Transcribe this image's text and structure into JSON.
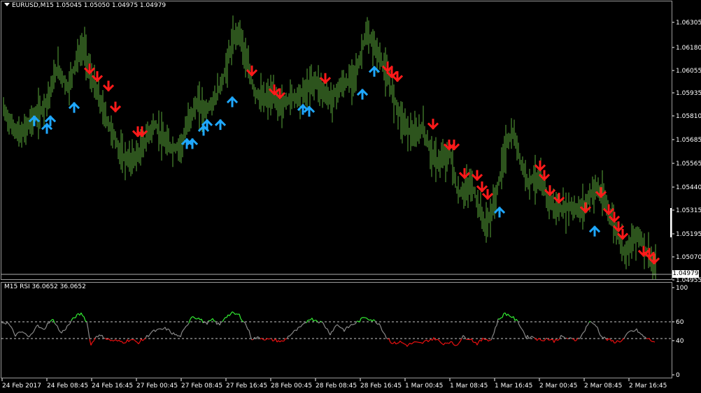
{
  "chart": {
    "header_label": "EURUSD,M15  1.05045 1.05050 1.04975 1.04979",
    "current_price": "1.04979",
    "price_ticks": [
      "1.06305",
      "1.06180",
      "1.06055",
      "1.05935",
      "1.05810",
      "1.05685",
      "1.05565",
      "1.05440",
      "1.05315",
      "1.05195",
      "1.05070",
      "1.04955"
    ],
    "time_ticks": [
      "24 Feb 2017",
      "24 Feb 08:45",
      "24 Feb 16:45",
      "27 Feb 00:45",
      "27 Feb 08:45",
      "27 Feb 16:45",
      "28 Feb 00:45",
      "28 Feb 08:45",
      "28 Feb 16:45",
      "1 Mar 00:45",
      "1 Mar 08:45",
      "1 Mar 16:45",
      "2 Mar 00:45",
      "2 Mar 08:45",
      "2 Mar 16:45"
    ],
    "colors": {
      "bar": "#5aa83a",
      "down_arrow": "#ff1a1a",
      "up_arrow": "#1fa8ff",
      "rsi_up": "#33ee33",
      "rsi_mid": "#8a8a8a",
      "rsi_down": "#ee1111"
    }
  },
  "rsi": {
    "label": "M15 RSI  36.0652 36.0652",
    "ticks": [
      "100",
      "60",
      "40",
      "0"
    ],
    "levels": [
      60,
      40
    ]
  },
  "chart_data": {
    "type": "line",
    "ylim": [
      1.0495,
      1.0636
    ],
    "close_series": [
      {
        "x": 0,
        "y": 1.0585
      },
      {
        "x": 15,
        "y": 1.0574
      },
      {
        "x": 28,
        "y": 1.0569
      },
      {
        "x": 42,
        "y": 1.0577
      },
      {
        "x": 55,
        "y": 1.0581
      },
      {
        "x": 68,
        "y": 1.059
      },
      {
        "x": 80,
        "y": 1.0605
      },
      {
        "x": 95,
        "y": 1.0594
      },
      {
        "x": 108,
        "y": 1.061
      },
      {
        "x": 118,
        "y": 1.0616
      },
      {
        "x": 128,
        "y": 1.06
      },
      {
        "x": 140,
        "y": 1.0588
      },
      {
        "x": 150,
        "y": 1.0578
      },
      {
        "x": 162,
        "y": 1.0568
      },
      {
        "x": 172,
        "y": 1.0558
      },
      {
        "x": 185,
        "y": 1.0556
      },
      {
        "x": 198,
        "y": 1.056
      },
      {
        "x": 210,
        "y": 1.057
      },
      {
        "x": 220,
        "y": 1.0575
      },
      {
        "x": 232,
        "y": 1.0566
      },
      {
        "x": 245,
        "y": 1.0562
      },
      {
        "x": 258,
        "y": 1.0564
      },
      {
        "x": 268,
        "y": 1.0578
      },
      {
        "x": 280,
        "y": 1.0586
      },
      {
        "x": 292,
        "y": 1.0582
      },
      {
        "x": 305,
        "y": 1.0588
      },
      {
        "x": 318,
        "y": 1.06
      },
      {
        "x": 330,
        "y": 1.0618
      },
      {
        "x": 340,
        "y": 1.0625
      },
      {
        "x": 350,
        "y": 1.0608
      },
      {
        "x": 362,
        "y": 1.0592
      },
      {
        "x": 375,
        "y": 1.0588
      },
      {
        "x": 388,
        "y": 1.059
      },
      {
        "x": 400,
        "y": 1.0584
      },
      {
        "x": 412,
        "y": 1.0589
      },
      {
        "x": 425,
        "y": 1.059
      },
      {
        "x": 438,
        "y": 1.0594
      },
      {
        "x": 450,
        "y": 1.0598
      },
      {
        "x": 462,
        "y": 1.0591
      },
      {
        "x": 472,
        "y": 1.0588
      },
      {
        "x": 485,
        "y": 1.0595
      },
      {
        "x": 498,
        "y": 1.0598
      },
      {
        "x": 510,
        "y": 1.0605
      },
      {
        "x": 520,
        "y": 1.0622
      },
      {
        "x": 530,
        "y": 1.0618
      },
      {
        "x": 540,
        "y": 1.0611
      },
      {
        "x": 552,
        "y": 1.06
      },
      {
        "x": 562,
        "y": 1.0588
      },
      {
        "x": 572,
        "y": 1.0578
      },
      {
        "x": 582,
        "y": 1.0572
      },
      {
        "x": 592,
        "y": 1.0568
      },
      {
        "x": 602,
        "y": 1.0574
      },
      {
        "x": 612,
        "y": 1.0562
      },
      {
        "x": 622,
        "y": 1.0555
      },
      {
        "x": 632,
        "y": 1.0557
      },
      {
        "x": 642,
        "y": 1.056
      },
      {
        "x": 652,
        "y": 1.0538
      },
      {
        "x": 662,
        "y": 1.054
      },
      {
        "x": 672,
        "y": 1.0544
      },
      {
        "x": 682,
        "y": 1.0532
      },
      {
        "x": 692,
        "y": 1.0521
      },
      {
        "x": 702,
        "y": 1.053
      },
      {
        "x": 712,
        "y": 1.0546
      },
      {
        "x": 722,
        "y": 1.0565
      },
      {
        "x": 732,
        "y": 1.057
      },
      {
        "x": 742,
        "y": 1.0556
      },
      {
        "x": 752,
        "y": 1.0545
      },
      {
        "x": 762,
        "y": 1.0547
      },
      {
        "x": 772,
        "y": 1.0544
      },
      {
        "x": 782,
        "y": 1.0535
      },
      {
        "x": 792,
        "y": 1.0531
      },
      {
        "x": 802,
        "y": 1.053
      },
      {
        "x": 812,
        "y": 1.0532
      },
      {
        "x": 822,
        "y": 1.053
      },
      {
        "x": 832,
        "y": 1.0531
      },
      {
        "x": 842,
        "y": 1.0538
      },
      {
        "x": 850,
        "y": 1.0542
      },
      {
        "x": 860,
        "y": 1.0536
      },
      {
        "x": 870,
        "y": 1.0528
      },
      {
        "x": 880,
        "y": 1.0518
      },
      {
        "x": 890,
        "y": 1.0508
      },
      {
        "x": 900,
        "y": 1.0512
      },
      {
        "x": 910,
        "y": 1.0518
      },
      {
        "x": 920,
        "y": 1.051
      },
      {
        "x": 930,
        "y": 1.0502
      },
      {
        "x": 935,
        "y": 1.0498
      }
    ],
    "down_signals": [
      {
        "x": 126,
        "y": 1.0602
      },
      {
        "x": 137,
        "y": 1.0598
      },
      {
        "x": 153,
        "y": 1.0593
      },
      {
        "x": 163,
        "y": 1.0582
      },
      {
        "x": 195,
        "y": 1.0569
      },
      {
        "x": 201,
        "y": 1.0569
      },
      {
        "x": 358,
        "y": 1.0601
      },
      {
        "x": 390,
        "y": 1.0591
      },
      {
        "x": 398,
        "y": 1.0589
      },
      {
        "x": 463,
        "y": 1.0597
      },
      {
        "x": 552,
        "y": 1.0603
      },
      {
        "x": 558,
        "y": 1.06
      },
      {
        "x": 566,
        "y": 1.0598
      },
      {
        "x": 617,
        "y": 1.0573
      },
      {
        "x": 640,
        "y": 1.0562
      },
      {
        "x": 647,
        "y": 1.0562
      },
      {
        "x": 662,
        "y": 1.0547
      },
      {
        "x": 680,
        "y": 1.0546
      },
      {
        "x": 687,
        "y": 1.054
      },
      {
        "x": 695,
        "y": 1.0536
      },
      {
        "x": 770,
        "y": 1.0551
      },
      {
        "x": 776,
        "y": 1.0546
      },
      {
        "x": 784,
        "y": 1.0538
      },
      {
        "x": 797,
        "y": 1.0534
      },
      {
        "x": 835,
        "y": 1.0529
      },
      {
        "x": 857,
        "y": 1.0537
      },
      {
        "x": 868,
        "y": 1.0528
      },
      {
        "x": 876,
        "y": 1.0524
      },
      {
        "x": 882,
        "y": 1.0519
      },
      {
        "x": 888,
        "y": 1.0515
      },
      {
        "x": 918,
        "y": 1.0506
      },
      {
        "x": 926,
        "y": 1.0505
      },
      {
        "x": 933,
        "y": 1.0502
      }
    ],
    "up_signals": [
      {
        "x": 47,
        "y": 1.0579
      },
      {
        "x": 65,
        "y": 1.0575
      },
      {
        "x": 70,
        "y": 1.0579
      },
      {
        "x": 104,
        "y": 1.0586
      },
      {
        "x": 265,
        "y": 1.0567
      },
      {
        "x": 273,
        "y": 1.0567
      },
      {
        "x": 289,
        "y": 1.0574
      },
      {
        "x": 294,
        "y": 1.0577
      },
      {
        "x": 313,
        "y": 1.0577
      },
      {
        "x": 330,
        "y": 1.0589
      },
      {
        "x": 431,
        "y": 1.0585
      },
      {
        "x": 440,
        "y": 1.0584
      },
      {
        "x": 516,
        "y": 1.0593
      },
      {
        "x": 533,
        "y": 1.0605
      },
      {
        "x": 712,
        "y": 1.0531
      },
      {
        "x": 848,
        "y": 1.0521
      }
    ],
    "rsi_values": [
      {
        "x": 0,
        "y": 60
      },
      {
        "x": 10,
        "y": 58
      },
      {
        "x": 20,
        "y": 44
      },
      {
        "x": 30,
        "y": 48
      },
      {
        "x": 40,
        "y": 41
      },
      {
        "x": 50,
        "y": 56
      },
      {
        "x": 60,
        "y": 50
      },
      {
        "x": 68,
        "y": 60
      },
      {
        "x": 75,
        "y": 62
      },
      {
        "x": 85,
        "y": 46
      },
      {
        "x": 95,
        "y": 55
      },
      {
        "x": 105,
        "y": 66
      },
      {
        "x": 115,
        "y": 70
      },
      {
        "x": 122,
        "y": 60
      },
      {
        "x": 128,
        "y": 32
      },
      {
        "x": 136,
        "y": 44
      },
      {
        "x": 146,
        "y": 42
      },
      {
        "x": 155,
        "y": 38
      },
      {
        "x": 165,
        "y": 37
      },
      {
        "x": 175,
        "y": 36
      },
      {
        "x": 185,
        "y": 39
      },
      {
        "x": 195,
        "y": 35
      },
      {
        "x": 205,
        "y": 40
      },
      {
        "x": 215,
        "y": 48
      },
      {
        "x": 225,
        "y": 50
      },
      {
        "x": 235,
        "y": 52
      },
      {
        "x": 245,
        "y": 46
      },
      {
        "x": 255,
        "y": 42
      },
      {
        "x": 265,
        "y": 55
      },
      {
        "x": 272,
        "y": 67
      },
      {
        "x": 282,
        "y": 64
      },
      {
        "x": 292,
        "y": 58
      },
      {
        "x": 302,
        "y": 62
      },
      {
        "x": 312,
        "y": 56
      },
      {
        "x": 320,
        "y": 66
      },
      {
        "x": 330,
        "y": 70
      },
      {
        "x": 340,
        "y": 68
      },
      {
        "x": 350,
        "y": 56
      },
      {
        "x": 358,
        "y": 40
      },
      {
        "x": 370,
        "y": 41
      },
      {
        "x": 380,
        "y": 39
      },
      {
        "x": 392,
        "y": 38
      },
      {
        "x": 402,
        "y": 36
      },
      {
        "x": 412,
        "y": 44
      },
      {
        "x": 422,
        "y": 50
      },
      {
        "x": 432,
        "y": 56
      },
      {
        "x": 440,
        "y": 64
      },
      {
        "x": 450,
        "y": 62
      },
      {
        "x": 460,
        "y": 58
      },
      {
        "x": 470,
        "y": 46
      },
      {
        "x": 480,
        "y": 57
      },
      {
        "x": 490,
        "y": 50
      },
      {
        "x": 500,
        "y": 56
      },
      {
        "x": 510,
        "y": 60
      },
      {
        "x": 520,
        "y": 66
      },
      {
        "x": 530,
        "y": 62
      },
      {
        "x": 540,
        "y": 58
      },
      {
        "x": 550,
        "y": 42
      },
      {
        "x": 560,
        "y": 34
      },
      {
        "x": 570,
        "y": 36
      },
      {
        "x": 580,
        "y": 32
      },
      {
        "x": 590,
        "y": 35
      },
      {
        "x": 600,
        "y": 34
      },
      {
        "x": 610,
        "y": 38
      },
      {
        "x": 620,
        "y": 40
      },
      {
        "x": 630,
        "y": 34
      },
      {
        "x": 640,
        "y": 36
      },
      {
        "x": 650,
        "y": 32
      },
      {
        "x": 660,
        "y": 42
      },
      {
        "x": 670,
        "y": 40
      },
      {
        "x": 680,
        "y": 34
      },
      {
        "x": 690,
        "y": 40
      },
      {
        "x": 700,
        "y": 38
      },
      {
        "x": 710,
        "y": 62
      },
      {
        "x": 720,
        "y": 70
      },
      {
        "x": 730,
        "y": 66
      },
      {
        "x": 740,
        "y": 58
      },
      {
        "x": 750,
        "y": 42
      },
      {
        "x": 760,
        "y": 42
      },
      {
        "x": 770,
        "y": 38
      },
      {
        "x": 780,
        "y": 40
      },
      {
        "x": 790,
        "y": 37
      },
      {
        "x": 800,
        "y": 42
      },
      {
        "x": 810,
        "y": 40
      },
      {
        "x": 820,
        "y": 38
      },
      {
        "x": 830,
        "y": 44
      },
      {
        "x": 840,
        "y": 60
      },
      {
        "x": 850,
        "y": 56
      },
      {
        "x": 858,
        "y": 42
      },
      {
        "x": 868,
        "y": 38
      },
      {
        "x": 878,
        "y": 36
      },
      {
        "x": 888,
        "y": 38
      },
      {
        "x": 898,
        "y": 48
      },
      {
        "x": 908,
        "y": 50
      },
      {
        "x": 918,
        "y": 42
      },
      {
        "x": 928,
        "y": 38
      },
      {
        "x": 935,
        "y": 36
      }
    ]
  }
}
